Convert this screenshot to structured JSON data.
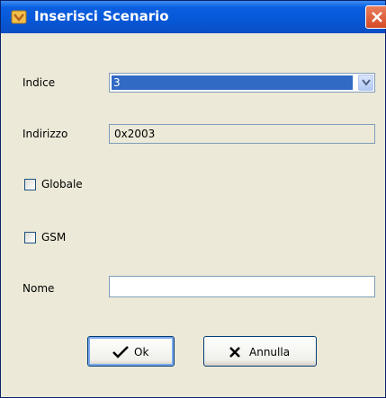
{
  "window": {
    "title": "Inserisci Scenario"
  },
  "form": {
    "indice_label": "Indice",
    "indice_value": "3",
    "indirizzo_label": "Indirizzo",
    "indirizzo_value": "0x2003",
    "globale_label": "Globale",
    "globale_checked": false,
    "gsm_label": "GSM",
    "gsm_checked": false,
    "nome_label": "Nome",
    "nome_value": ""
  },
  "buttons": {
    "ok_label": "Ok",
    "cancel_label": "Annulla"
  },
  "colors": {
    "titlebar": "#0758d7",
    "background": "#ece9d8",
    "selection": "#316ac5"
  }
}
